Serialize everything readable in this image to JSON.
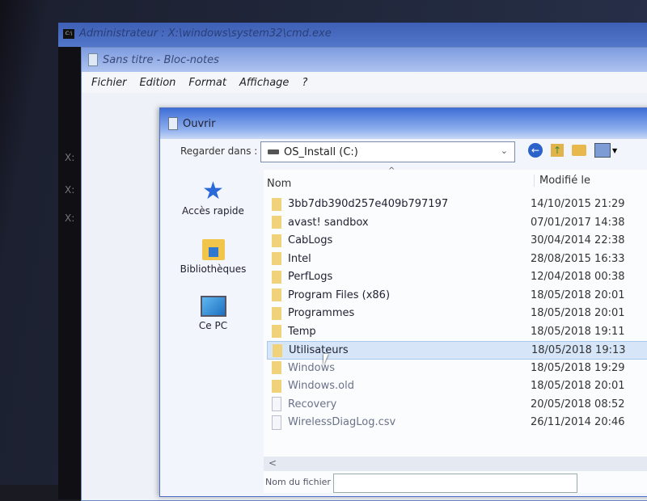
{
  "cmd": {
    "title": "Administrateur : X:\\windows\\system32\\cmd.exe",
    "icon_label": "C:\\",
    "lines": [
      "X:",
      "X:",
      "X:"
    ]
  },
  "notepad": {
    "title": "Sans titre - Bloc-notes",
    "menu": [
      "Fichier",
      "Edition",
      "Format",
      "Affichage",
      "?"
    ]
  },
  "dialog": {
    "title": "Ouvrir",
    "look_in_label": "Regarder dans :",
    "look_in_value": "OS_Install (C:)",
    "toolbar_icons": [
      "back-icon",
      "up-folder-icon",
      "new-folder-icon",
      "view-menu-icon"
    ],
    "nav": [
      {
        "label": "Accès rapide",
        "icon": "star-icon"
      },
      {
        "label": "Bibliothèques",
        "icon": "library-icon"
      },
      {
        "label": "Ce PC",
        "icon": "computer-icon"
      }
    ],
    "columns": {
      "name": "Nom",
      "modified": "Modifié le"
    },
    "files": [
      {
        "name": "3bb7db390d257e409b797197",
        "modified": "14/10/2015 21:29",
        "type": "folder"
      },
      {
        "name": "avast! sandbox",
        "modified": "07/01/2017 14:38",
        "type": "folder"
      },
      {
        "name": "CabLogs",
        "modified": "30/04/2014 22:38",
        "type": "folder"
      },
      {
        "name": "Intel",
        "modified": "28/08/2015 16:33",
        "type": "folder"
      },
      {
        "name": "PerfLogs",
        "modified": "12/04/2018 00:38",
        "type": "folder"
      },
      {
        "name": "Program Files (x86)",
        "modified": "18/05/2018 20:01",
        "type": "folder"
      },
      {
        "name": "Programmes",
        "modified": "18/05/2018 20:01",
        "type": "folder"
      },
      {
        "name": "Temp",
        "modified": "18/05/2018 19:11",
        "type": "folder"
      },
      {
        "name": "Utilisateurs",
        "modified": "18/05/2018 19:13",
        "type": "folder",
        "selected": true
      },
      {
        "name": "Windows",
        "modified": "18/05/2018 19:29",
        "type": "folder"
      },
      {
        "name": "Windows.old",
        "modified": "18/05/2018 20:01",
        "type": "folder"
      },
      {
        "name": "Recovery",
        "modified": "20/05/2018 08:52",
        "type": "file"
      },
      {
        "name": "WirelessDiagLog.csv",
        "modified": "26/11/2014 20:46",
        "type": "file"
      }
    ],
    "scroll_left": "<",
    "filename_label": "Nom du fichier :"
  }
}
